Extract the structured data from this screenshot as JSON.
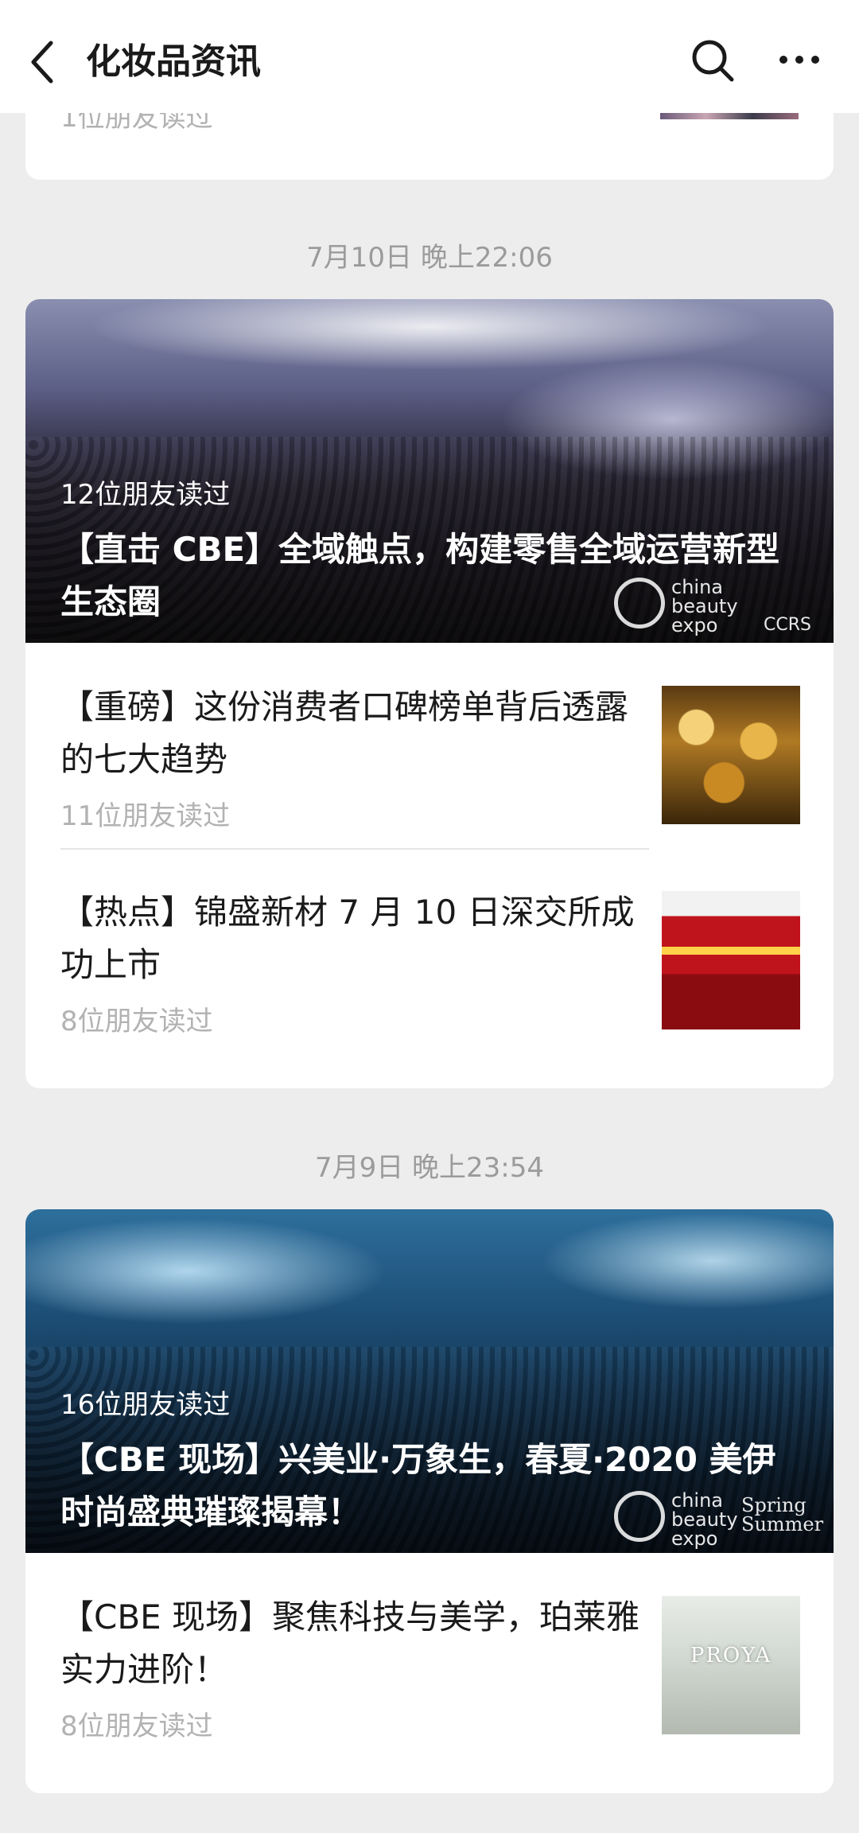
{
  "topbar": {
    "title": "化妆品资讯",
    "back_icon": "chevron-left-icon",
    "search_icon": "search-icon",
    "more_icon": "more-dots-icon"
  },
  "prev_card": {
    "read_count": "1位朋友读过"
  },
  "groups": [
    {
      "timestamp": "7月10日 晚上22:06",
      "hero": {
        "read_count": "12位朋友读过",
        "title": "【直击 CBE】全域触点，构建零售全域运营新型生态圈",
        "logo_text": "china beauty expo",
        "logo_text_2": "CCRS"
      },
      "items": [
        {
          "title": "【重磅】这份消费者口碑榜单背后透露的七大趋势",
          "read_count": "11位朋友读过"
        },
        {
          "title": "【热点】锦盛新材 7 月 10 日深交所成功上市",
          "read_count": "8位朋友读过"
        }
      ]
    },
    {
      "timestamp": "7月9日 晚上23:54",
      "hero": {
        "read_count": "16位朋友读过",
        "title": "【CBE 现场】兴美业·万象生，春夏·2020 美伊时尚盛典璀璨揭幕！",
        "logo_text": "china beauty expo",
        "logo_text_2": "Spring Summer"
      },
      "items": [
        {
          "title": "【CBE 现场】聚焦科技与美学，珀莱雅实力进阶！",
          "read_count": "8位朋友读过",
          "thumb_text": "PROYA"
        }
      ]
    }
  ]
}
